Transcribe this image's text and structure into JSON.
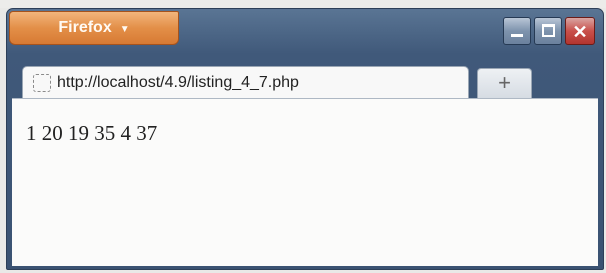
{
  "window": {
    "app_button_label": "Firefox",
    "app_button_icon": "chevron-down-icon",
    "controls": {
      "minimize_icon": "minimize-icon",
      "maximize_icon": "maximize-icon",
      "close_icon": "close-icon",
      "close_glyph": "✕"
    }
  },
  "tab": {
    "favicon": "page-icon",
    "label": "http://localhost/4.9/listing_4_7.php"
  },
  "newtab": {
    "icon": "plus-icon",
    "glyph": "+"
  },
  "page": {
    "output": "1 20 19 35 4 37"
  },
  "colors": {
    "app_button": "#e38f48",
    "frame": "#40597a",
    "close": "#c9504b"
  }
}
